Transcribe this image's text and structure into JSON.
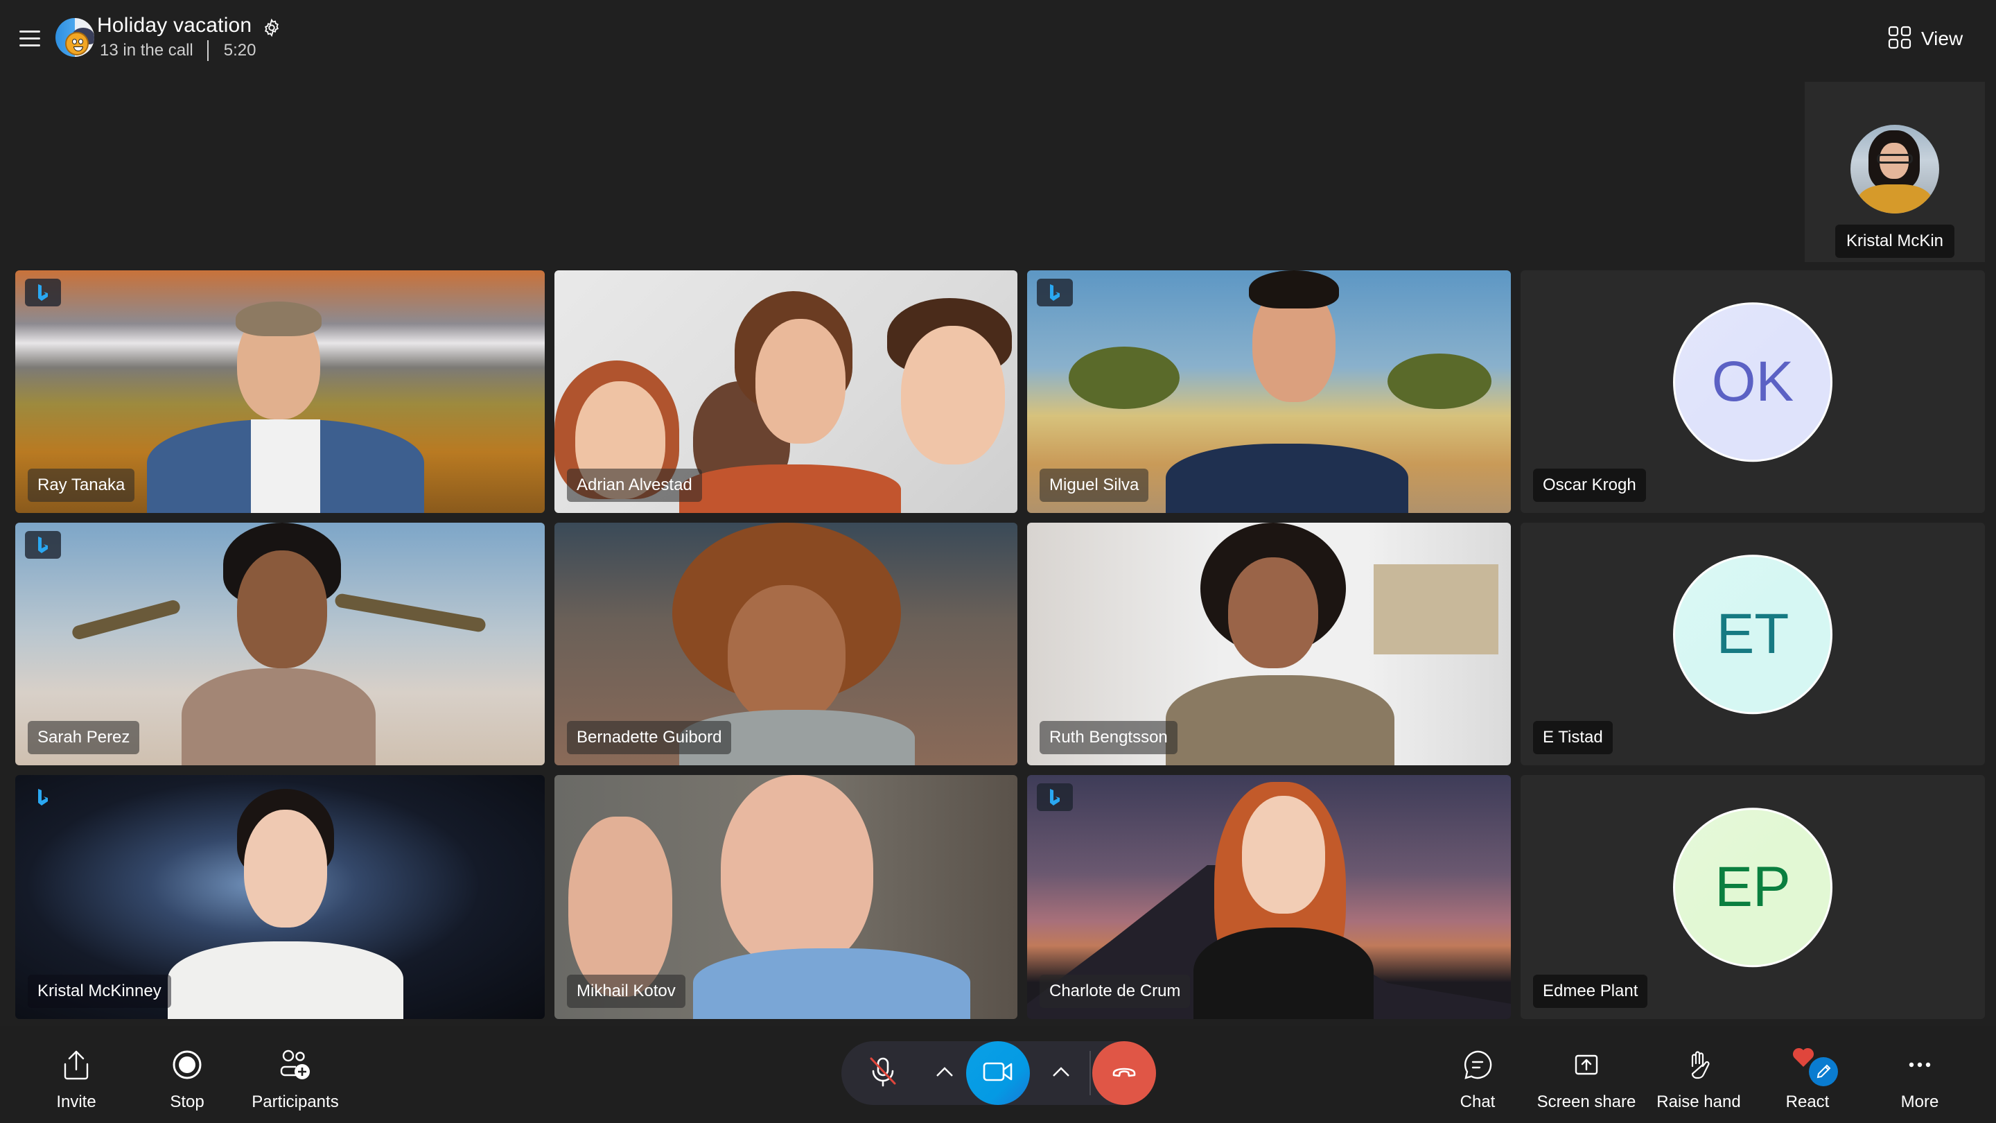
{
  "header": {
    "title": "Holiday vacation",
    "participant_count": "13 in the call",
    "duration": "5:20",
    "menu_icon": "hamburger-icon",
    "settings_icon": "gear-icon",
    "view_label": "View",
    "view_icon": "grid-icon"
  },
  "self_view": {
    "name": "Kristal McKin"
  },
  "participants": [
    {
      "name": "Ray Tanaka",
      "type": "video",
      "background_effect": true
    },
    {
      "name": "Adrian Alvestad",
      "type": "video",
      "background_effect": false
    },
    {
      "name": "Miguel Silva",
      "type": "video",
      "background_effect": true
    },
    {
      "name": "Oscar Krogh",
      "type": "avatar",
      "initials": "OK",
      "avatar_bg": "#dfe3fb",
      "avatar_fg": "#5b61c4"
    },
    {
      "name": "Sarah Perez",
      "type": "video",
      "background_effect": true
    },
    {
      "name": "Bernadette Guibord",
      "type": "video",
      "background_effect": false
    },
    {
      "name": "Ruth Bengtsson",
      "type": "video",
      "background_effect": false
    },
    {
      "name": "E Tistad",
      "type": "avatar",
      "initials": "ET",
      "avatar_bg": "#d6f7f3",
      "avatar_fg": "#167a82"
    },
    {
      "name": "Kristal McKinney",
      "type": "video",
      "background_effect": true
    },
    {
      "name": "Mikhail Kotov",
      "type": "video",
      "background_effect": false
    },
    {
      "name": "Charlote de Crum",
      "type": "video",
      "background_effect": true
    },
    {
      "name": "Edmee Plant",
      "type": "avatar",
      "initials": "EP",
      "avatar_bg": "#e2f8d4",
      "avatar_fg": "#0a7f3f"
    }
  ],
  "toolbar": {
    "left": [
      {
        "label": "Invite",
        "icon": "share-upload-icon"
      },
      {
        "label": "Stop",
        "icon": "record-stop-icon"
      },
      {
        "label": "Participants",
        "icon": "add-participant-icon"
      }
    ],
    "call_controls": {
      "mic_state": "muted",
      "camera_state": "on",
      "mic_icon": "mic-off-icon",
      "camera_icon": "video-camera-icon",
      "hangup_icon": "hang-up-icon",
      "accent_color": "#0aa0e6",
      "hangup_color": "#e05646"
    },
    "right": [
      {
        "label": "Chat",
        "icon": "chat-bubble-icon"
      },
      {
        "label": "Screen share",
        "icon": "screen-share-icon"
      },
      {
        "label": "Raise hand",
        "icon": "raise-hand-icon"
      },
      {
        "label": "React",
        "icon": "heart-react-icon"
      },
      {
        "label": "More",
        "icon": "more-dots-icon"
      }
    ]
  }
}
